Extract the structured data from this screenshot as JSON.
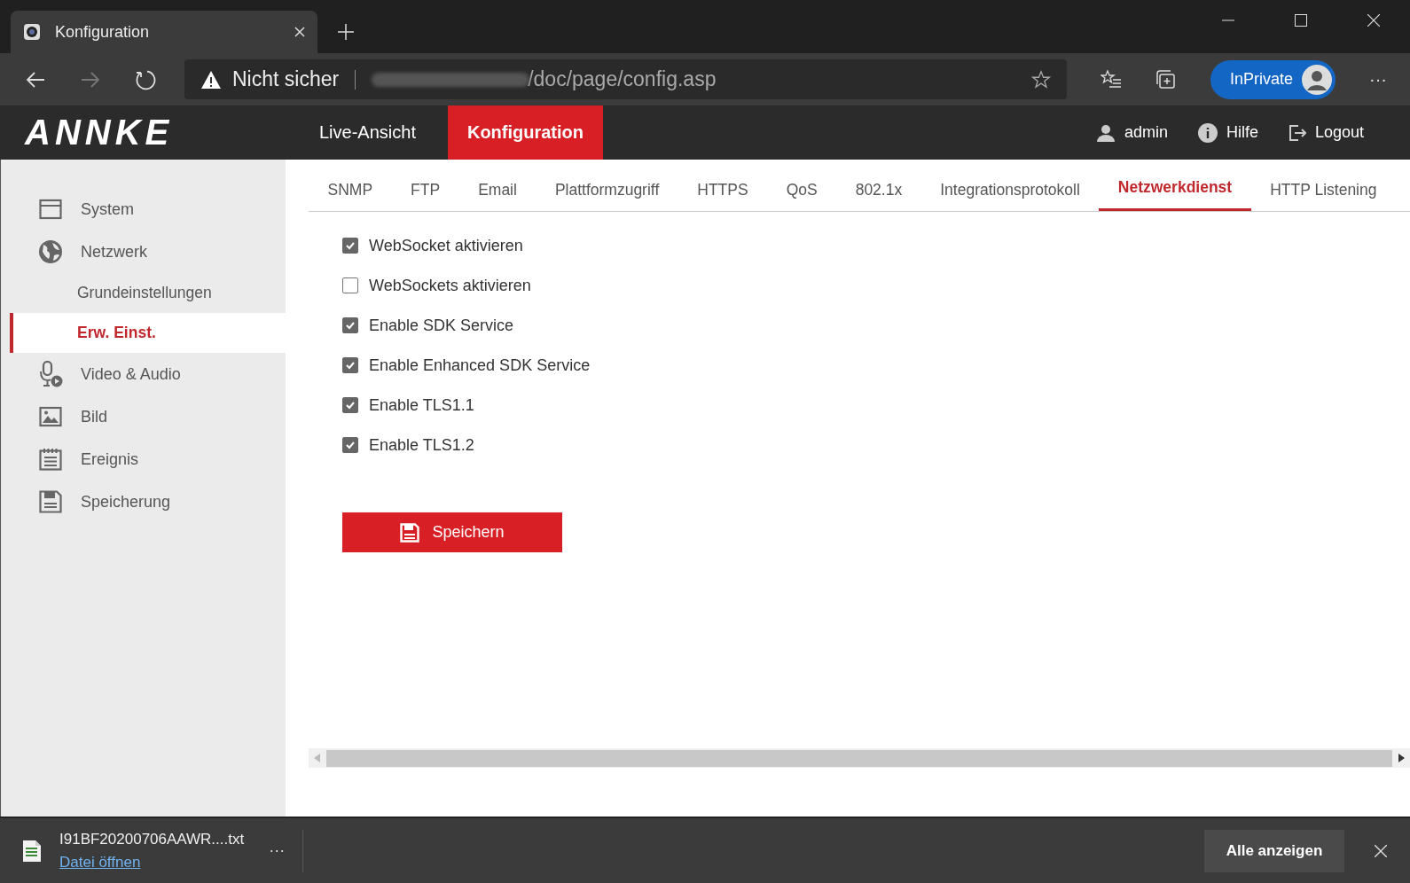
{
  "browser": {
    "tab_title": "Konfiguration",
    "security": "Nicht sicher",
    "url": "/doc/page/config.asp",
    "profile": "InPrivate",
    "menu": "···"
  },
  "header": {
    "logo": "ANNKE",
    "nav": [
      {
        "label": "Live-Ansicht",
        "selected": false
      },
      {
        "label": "Konfiguration",
        "selected": true
      }
    ],
    "user": "admin",
    "help": "Hilfe",
    "logout": "Logout"
  },
  "sidebar": {
    "items": [
      {
        "label": "System"
      },
      {
        "label": "Netzwerk",
        "children": [
          {
            "label": "Grundeinstellungen",
            "selected": false
          },
          {
            "label": "Erw. Einst.",
            "selected": true
          }
        ]
      },
      {
        "label": "Video & Audio"
      },
      {
        "label": "Bild"
      },
      {
        "label": "Ereignis"
      },
      {
        "label": "Speicherung"
      }
    ]
  },
  "tabs": [
    {
      "label": "SNMP",
      "selected": false
    },
    {
      "label": "FTP",
      "selected": false
    },
    {
      "label": "Email",
      "selected": false
    },
    {
      "label": "Plattformzugriff",
      "selected": false
    },
    {
      "label": "HTTPS",
      "selected": false
    },
    {
      "label": "QoS",
      "selected": false
    },
    {
      "label": "802.1x",
      "selected": false
    },
    {
      "label": "Integrationsprotokoll",
      "selected": false
    },
    {
      "label": "Netzwerkdienst",
      "selected": true
    },
    {
      "label": "HTTP Listening",
      "selected": false
    }
  ],
  "options": [
    {
      "label": "WebSocket aktivieren",
      "checked": true
    },
    {
      "label": "WebSockets aktivieren",
      "checked": false
    },
    {
      "label": "Enable SDK Service",
      "checked": true
    },
    {
      "label": "Enable Enhanced SDK Service",
      "checked": true
    },
    {
      "label": "Enable TLS1.1",
      "checked": true
    },
    {
      "label": "Enable TLS1.2",
      "checked": true
    }
  ],
  "save_button": "Speichern",
  "download_bar": {
    "file": "I91BF20200706AAWR....txt",
    "open_link": "Datei öffnen",
    "more": "···",
    "show_all": "Alle anzeigen"
  }
}
